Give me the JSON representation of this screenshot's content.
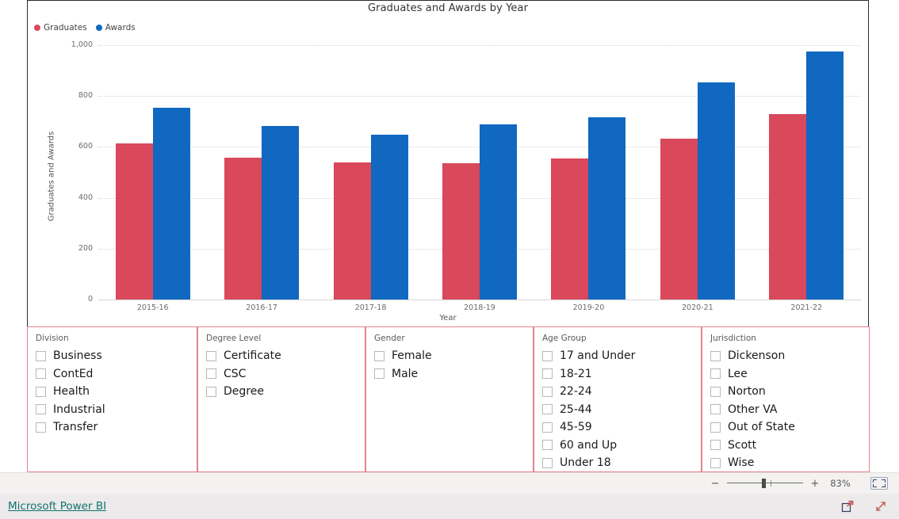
{
  "chart": {
    "title": "Graduates and Awards by Year",
    "legend": [
      {
        "label": "Graduates",
        "color": "#D9485B"
      },
      {
        "label": "Awards",
        "color": "#1068C0"
      }
    ]
  },
  "chart_data": {
    "type": "bar",
    "title": "Graduates and Awards by Year",
    "xlabel": "Year",
    "ylabel": "Graduates and Awards",
    "categories": [
      "2015-16",
      "2016-17",
      "2017-18",
      "2018-19",
      "2019-20",
      "2020-21",
      "2021-22"
    ],
    "series": [
      {
        "name": "Graduates",
        "color": "#D9485B",
        "values": [
          614,
          558,
          539,
          536,
          555,
          633,
          728
        ]
      },
      {
        "name": "Awards",
        "color": "#1068C0",
        "values": [
          755,
          682,
          648,
          688,
          717,
          853,
          975
        ]
      }
    ],
    "ylim": [
      0,
      1000
    ],
    "yticks": [
      "0",
      "200",
      "400",
      "600",
      "800",
      "1,000"
    ],
    "ytick_values": [
      0,
      200,
      400,
      600,
      800,
      1000
    ],
    "grid": true,
    "legend_position": "top-left"
  },
  "slicers": [
    {
      "title": "Division",
      "items": [
        "Business",
        "ContEd",
        "Health",
        "Industrial",
        "Transfer"
      ]
    },
    {
      "title": "Degree Level",
      "items": [
        "Certificate",
        "CSC",
        "Degree"
      ]
    },
    {
      "title": "Gender",
      "items": [
        "Female",
        "Male"
      ]
    },
    {
      "title": "Age Group",
      "items": [
        "17 and Under",
        "18-21",
        "22-24",
        "25-44",
        "45-59",
        "60 and Up",
        "Under 18"
      ]
    },
    {
      "title": "Jurisdiction",
      "items": [
        "Dickenson",
        "Lee",
        "Norton",
        "Other VA",
        "Out of State",
        "Scott",
        "Wise"
      ]
    }
  ],
  "zoombar": {
    "zoom_out_label": "−",
    "zoom_in_label": "+",
    "zoom_value": "83%",
    "fit_icon": "fit-to-page-icon"
  },
  "footer": {
    "brand": "Microsoft Power BI",
    "share_icon": "share-icon",
    "fullscreen_icon": "fullscreen-icon"
  }
}
